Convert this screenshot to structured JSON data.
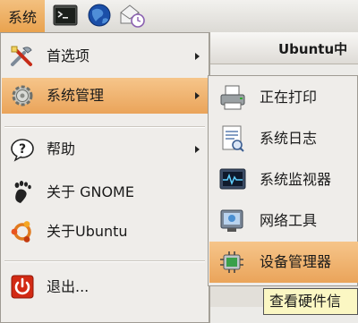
{
  "panel": {
    "menu_label": "系统",
    "icons": [
      "terminal-icon",
      "browser-globe-icon",
      "mail-clock-icon"
    ]
  },
  "background_window": {
    "title": "Ubuntu中"
  },
  "main_menu": {
    "items": [
      {
        "label": "首选项",
        "icon": "preferences-icon",
        "has_submenu": true
      },
      {
        "label": "系统管理",
        "icon": "administration-gear-icon",
        "has_submenu": true,
        "active": true
      },
      {
        "label": "帮助",
        "icon": "help-icon",
        "has_submenu": true
      },
      {
        "label": "关于 GNOME",
        "icon": "gnome-foot-icon",
        "has_submenu": false
      },
      {
        "label": "关于Ubuntu",
        "icon": "ubuntu-logo-icon",
        "has_submenu": false
      },
      {
        "label": "退出...",
        "icon": "logout-power-icon",
        "has_submenu": false
      }
    ]
  },
  "sub_menu": {
    "items": [
      {
        "label": "正在打印",
        "icon": "printer-icon"
      },
      {
        "label": "系统日志",
        "icon": "system-log-icon"
      },
      {
        "label": "系统监视器",
        "icon": "system-monitor-icon"
      },
      {
        "label": "网络工具",
        "icon": "network-tools-icon"
      },
      {
        "label": "设备管理器",
        "icon": "device-manager-icon",
        "active": true
      }
    ]
  },
  "tooltip": {
    "text": "查看硬件信"
  },
  "colors": {
    "highlight": "#eaa45a",
    "menu_bg": "#efedea",
    "tooltip_bg": "#fbf7c3"
  }
}
